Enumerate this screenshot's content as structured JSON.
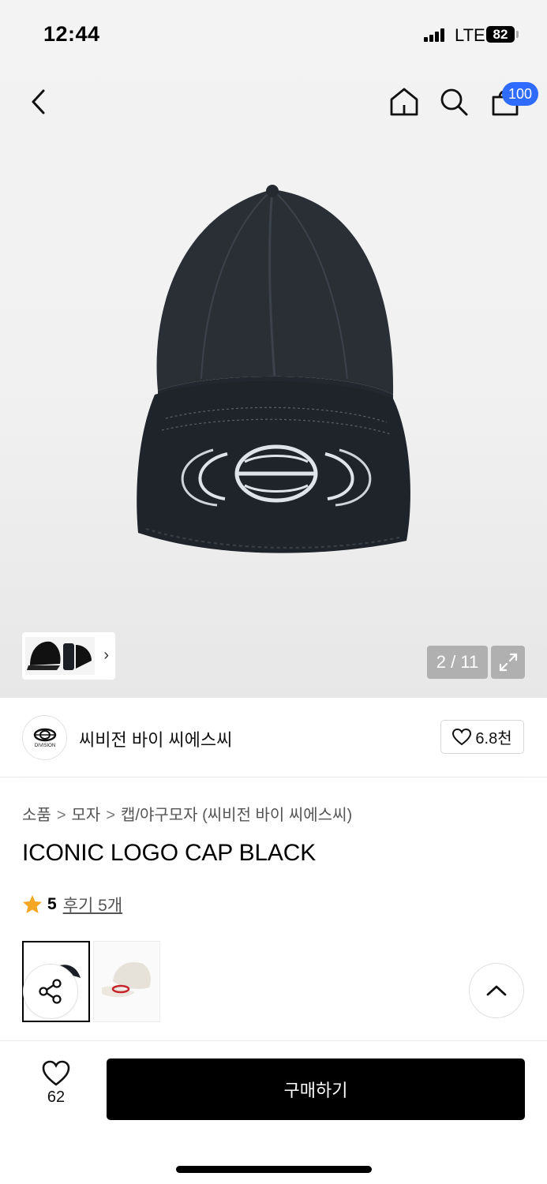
{
  "status_bar": {
    "time": "12:44",
    "network": "LTE",
    "battery": "82"
  },
  "nav": {
    "cart_count": "100"
  },
  "gallery": {
    "page_indicator": "2 / 11"
  },
  "brand": {
    "logo_text": "DIVISION",
    "name": "씨비전 바이 씨에스씨",
    "like_count": "6.8천"
  },
  "breadcrumb": [
    "소품",
    "모자",
    "캡/야구모자 (씨비전 바이 씨에스씨)"
  ],
  "product": {
    "title": "ICONIC LOGO CAP BLACK",
    "rating": "5",
    "review_link": "후기 5개"
  },
  "bottom_bar": {
    "wish_count": "62",
    "buy_label": "구매하기"
  },
  "colors": {
    "accent_badge": "#2f6bff",
    "star": "#f5a623",
    "buy_button": "#000000"
  },
  "icons": [
    "back-icon",
    "home-icon",
    "search-icon",
    "cart-icon",
    "expand-icon",
    "heart-icon",
    "star-icon",
    "share-icon",
    "chevron-up-icon"
  ]
}
